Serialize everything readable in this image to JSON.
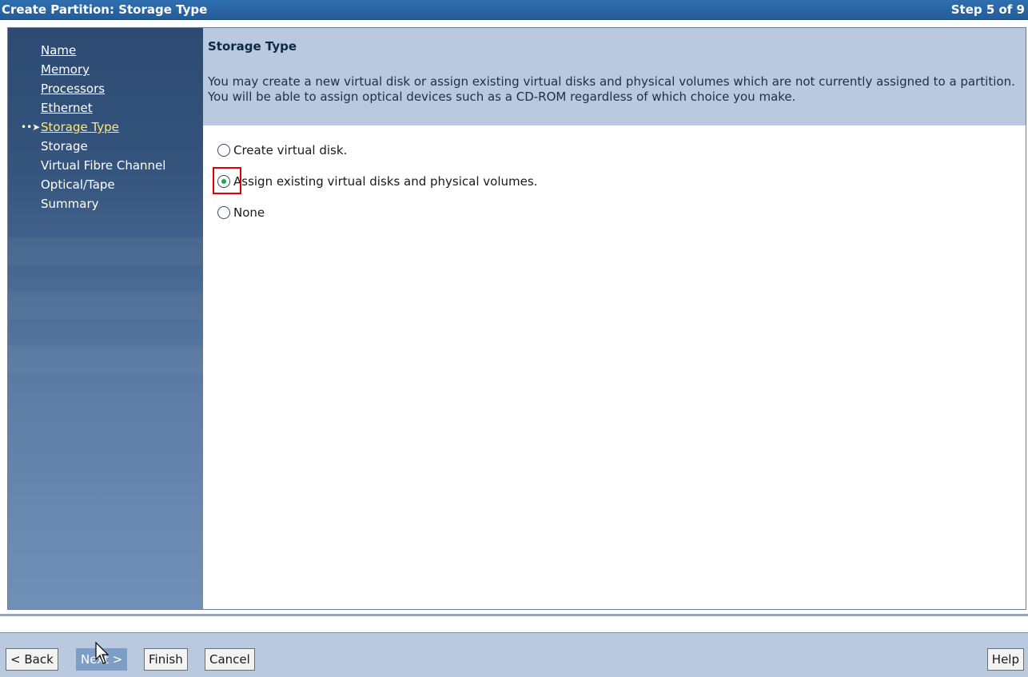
{
  "window": {
    "title": "Create Partition: Storage Type",
    "step": "Step 5 of 9"
  },
  "nav": {
    "items": [
      {
        "label": "Name",
        "link": true,
        "current": false
      },
      {
        "label": "Memory",
        "link": true,
        "current": false
      },
      {
        "label": "Processors",
        "link": true,
        "current": false
      },
      {
        "label": "Ethernet",
        "link": true,
        "current": false
      },
      {
        "label": "Storage Type",
        "link": true,
        "current": true
      },
      {
        "label": "Storage",
        "link": false,
        "current": false
      },
      {
        "label": "Virtual Fibre Channel",
        "link": false,
        "current": false
      },
      {
        "label": "Optical/Tape",
        "link": false,
        "current": false
      },
      {
        "label": "Summary",
        "link": false,
        "current": false
      }
    ],
    "current_indicator_icon": "dotted-arrow-icon"
  },
  "main": {
    "heading": "Storage Type",
    "description": "You may create a new virtual disk or assign existing virtual disks and physical volumes which are not currently assigned to a partition. You will be able to assign optical devices such as a CD-ROM regardless of which choice you make.",
    "options": [
      {
        "label": "Create virtual disk.",
        "selected": false
      },
      {
        "label": "Assign existing virtual disks and physical volumes.",
        "selected": true
      },
      {
        "label": "None",
        "selected": false
      }
    ]
  },
  "footer": {
    "back_label": "< Back",
    "next_label": "Next >",
    "finish_label": "Finish",
    "cancel_label": "Cancel",
    "help_label": "Help"
  },
  "colors": {
    "titlebar": "#2a66a4",
    "header_bg": "#b9c9e0",
    "selected_radio": "#1aa84a",
    "highlight_box": "#e00000",
    "current_nav_link": "#ffe680"
  }
}
